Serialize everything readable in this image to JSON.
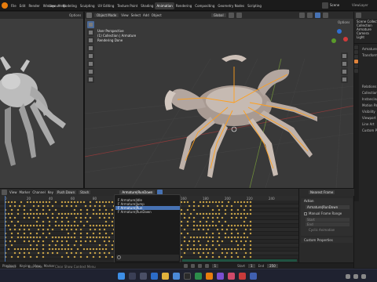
{
  "topbar": {
    "menus": [
      "File",
      "Edit",
      "Render",
      "Window",
      "Help"
    ],
    "workspaces": [
      "Layout",
      "Modeling",
      "Sculpting",
      "UV Editing",
      "Texture Paint",
      "Shading",
      "Animation",
      "Rendering",
      "Compositing",
      "Geometry Nodes",
      "Scripting"
    ],
    "active_workspace": "Animation",
    "scene_label": "Scene",
    "view_layer_label": "ViewLayer"
  },
  "left_viewport": {
    "options_label": "Options"
  },
  "viewport": {
    "mode": "Object Mode",
    "menus": [
      "View",
      "Select",
      "Add",
      "Object"
    ],
    "orientation": "Global",
    "options_label": "Options",
    "overlay_lines": [
      "User Perspective",
      "(1) Collection | Armature",
      "Rendering Done"
    ]
  },
  "dopesheet": {
    "menus": [
      "View",
      "Marker",
      "Channel",
      "Key"
    ],
    "mode": "Push Down",
    "stash": "Stash",
    "action_name": "Armature|RunDown",
    "frame_numbers": [
      "0",
      "20",
      "40",
      "60",
      "80",
      "100",
      "120",
      "140",
      "160",
      "180",
      "200",
      "220",
      "240"
    ],
    "actions": [
      "F Armature|Idle",
      "F Armature|Jump",
      "F Armature|Run",
      "F Armature|RunDown"
    ],
    "selected_action": 2,
    "search_placeholder": ""
  },
  "nla_sidebar": {
    "header": "Nearest Frame",
    "section_action": "Action",
    "action_value": "Armature|RunDown",
    "manual_frame_range": "Manual Frame Range",
    "start_label": "Start",
    "end_label": "End",
    "cyclic_label": "Cyclic Animation",
    "custom_properties": "Custom Properties"
  },
  "outliner": {
    "rows": [
      "Scene Collection",
      "Collection",
      "Armature",
      "Camera",
      "Light"
    ]
  },
  "properties": {
    "rows": [
      "Armature",
      "Transform",
      "",
      "",
      "",
      "",
      "Relations",
      "Collections",
      "Instancing",
      "Motion Paths",
      "Visibility",
      "Viewport Display",
      "Line Art",
      "Custom Properties"
    ]
  },
  "timeline_footer": {
    "playback": "Playback",
    "keying": "Keying",
    "view": "View",
    "marker": "Marker",
    "start_label": "Start",
    "start_value": "1",
    "end_label": "End",
    "end_value": "250",
    "current_frame": "1"
  },
  "statusbar": {
    "left": "Select",
    "middle": "Pan View",
    "right": "Clear Show Context Menu"
  },
  "colors": {
    "accent": "#4772b3",
    "keyframe": "#e5b84c",
    "active_workspace": "#3a3a3a",
    "nla_green": "#1f5a46"
  }
}
